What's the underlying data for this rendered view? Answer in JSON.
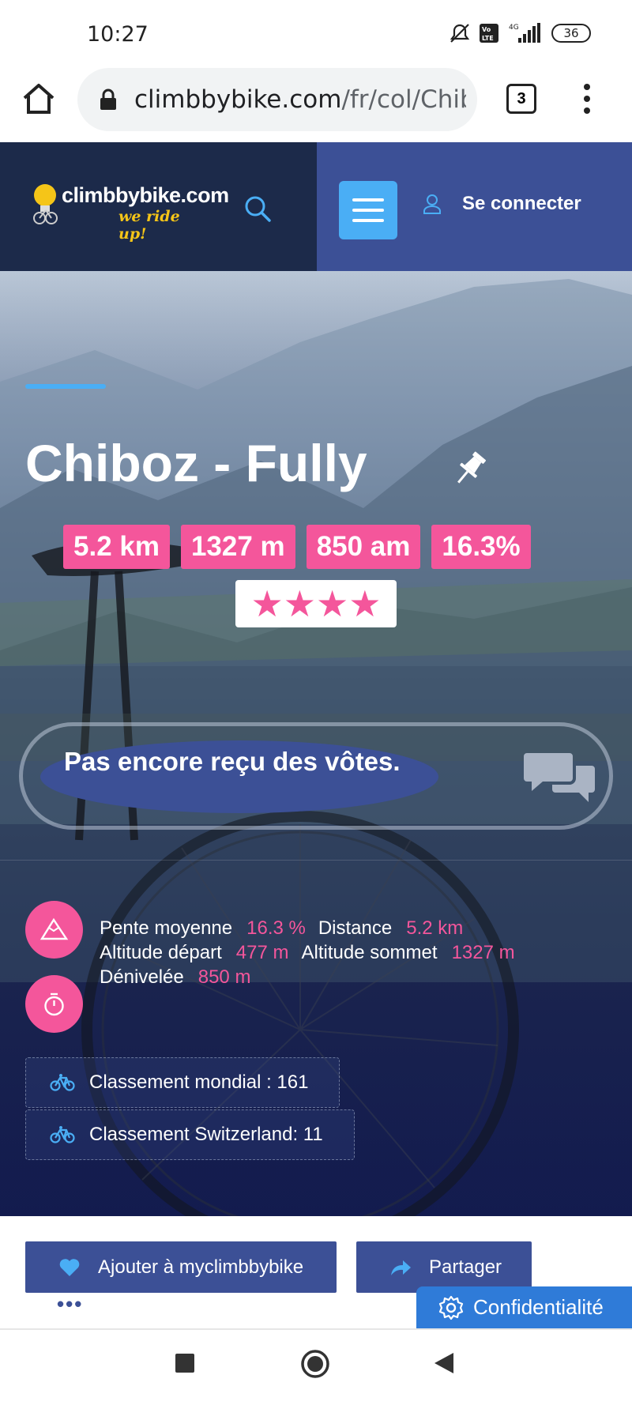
{
  "status_bar": {
    "time": "10:27",
    "battery": "36",
    "network": "4G",
    "icons": [
      "mute-icon",
      "volte-icon",
      "signal-icon",
      "battery-icon"
    ]
  },
  "browser": {
    "url_domain": "climbbybike.com",
    "url_path": "/fr/col/Chib",
    "tab_count": "3"
  },
  "header": {
    "logo_main": "climbbybike.com",
    "logo_sub": "we ride up!",
    "login_label": "Se connecter"
  },
  "hero": {
    "title": "Chiboz - Fully",
    "stats": [
      "5.2 km",
      "1327 m",
      "850 am",
      "16.3%"
    ],
    "rating_stars": 4,
    "stars": "★★★★",
    "vote_message": "Pas encore reçu des vôtes."
  },
  "specs": {
    "pente_label": "Pente moyenne",
    "pente_value": "16.3 %",
    "distance_label": "Distance",
    "distance_value": "5.2 km",
    "alt_depart_label": "Altitude départ",
    "alt_depart_value": "477 m",
    "alt_sommet_label": "Altitude sommet",
    "alt_sommet_value": "1327 m",
    "denivelee_label": "Dénivelée",
    "denivelee_value": "850 m"
  },
  "rankings": {
    "world": "Classement mondial : 161",
    "country": "Classement Switzerland: 11"
  },
  "actions": {
    "favorite_label": "Ajouter à myclimbbybike",
    "share_label": "Partager",
    "more": "•••",
    "privacy_label": "Confidentialité"
  },
  "colors": {
    "accent_pink": "#f4569b",
    "header_dark": "#1c2a4a",
    "header_blue": "#3c5096",
    "accent_blue": "#4aaef5"
  }
}
